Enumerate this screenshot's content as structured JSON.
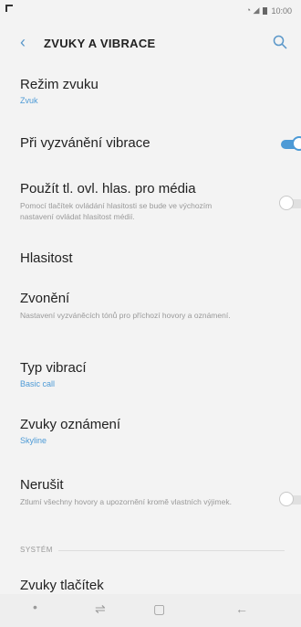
{
  "status": {
    "time": "10:00"
  },
  "header": {
    "title": "ZVUKY A VIBRACE"
  },
  "items": [
    {
      "title": "Režim zvuku",
      "sub": "Zvuk"
    },
    {
      "title": "Při vyzvánění vibrace",
      "toggle": "on"
    },
    {
      "title": "Použít tl. ovl. hlas. pro média",
      "desc": "Pomocí tlačítek ovládání hlasitosti se bude ve výchozím nastavení ovládat hlasitost médií.",
      "toggle": "off"
    },
    {
      "title": "Hlasitost"
    },
    {
      "title": "Zvonění",
      "desc": "Nastavení vyzváněcích tónů pro příchozí hovory a oznámení."
    },
    {
      "title": "Typ vibrací",
      "sub": "Basic call"
    },
    {
      "title": "Zvuky oznámení",
      "sub": "Skyline"
    },
    {
      "title": "Nerušit",
      "desc": "Ztlumí všechny hovory a upozornění kromě vlastních výjimek.",
      "toggle": "off"
    }
  ],
  "section": {
    "label": "SYSTÉM"
  },
  "last_item": {
    "title": "Zvuky tlačítek"
  }
}
